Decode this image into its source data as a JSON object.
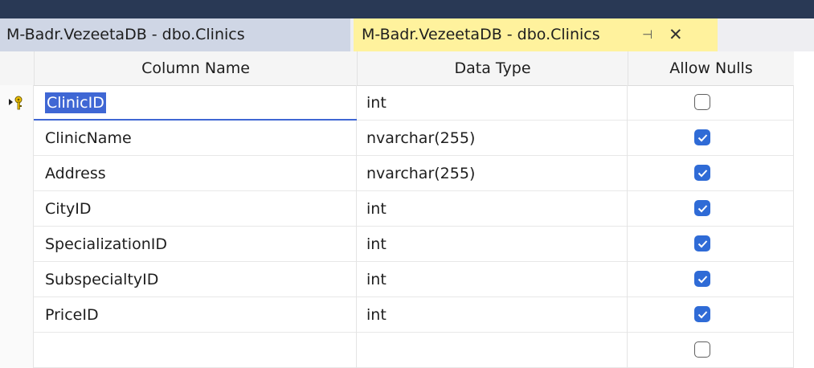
{
  "tabs": [
    {
      "label": "M-Badr.VezeetaDB - dbo.Clinics",
      "active": false
    },
    {
      "label": "M-Badr.VezeetaDB - dbo.Clinics",
      "active": true,
      "pin_icon": "pin-icon",
      "close_icon": "close-icon"
    }
  ],
  "grid": {
    "headers": {
      "column_name": "Column Name",
      "data_type": "Data Type",
      "allow_nulls": "Allow Nulls"
    },
    "rows": [
      {
        "column_name": "ClinicID",
        "data_type": "int",
        "allow_nulls": false,
        "primary_key": true,
        "selected": true
      },
      {
        "column_name": "ClinicName",
        "data_type": "nvarchar(255)",
        "allow_nulls": true
      },
      {
        "column_name": "Address",
        "data_type": "nvarchar(255)",
        "allow_nulls": true
      },
      {
        "column_name": "CityID",
        "data_type": "int",
        "allow_nulls": true
      },
      {
        "column_name": "SpecializationID",
        "data_type": "int",
        "allow_nulls": true
      },
      {
        "column_name": "SubspecialtyID",
        "data_type": "int",
        "allow_nulls": true
      },
      {
        "column_name": "PriceID",
        "data_type": "int",
        "allow_nulls": true
      },
      {
        "column_name": "",
        "data_type": "",
        "allow_nulls": false
      }
    ]
  },
  "colors": {
    "selection": "#3f67d4",
    "checkbox_checked": "#2f6bd6",
    "active_tab": "#fff29d",
    "inactive_tab": "#cfd6e5"
  }
}
